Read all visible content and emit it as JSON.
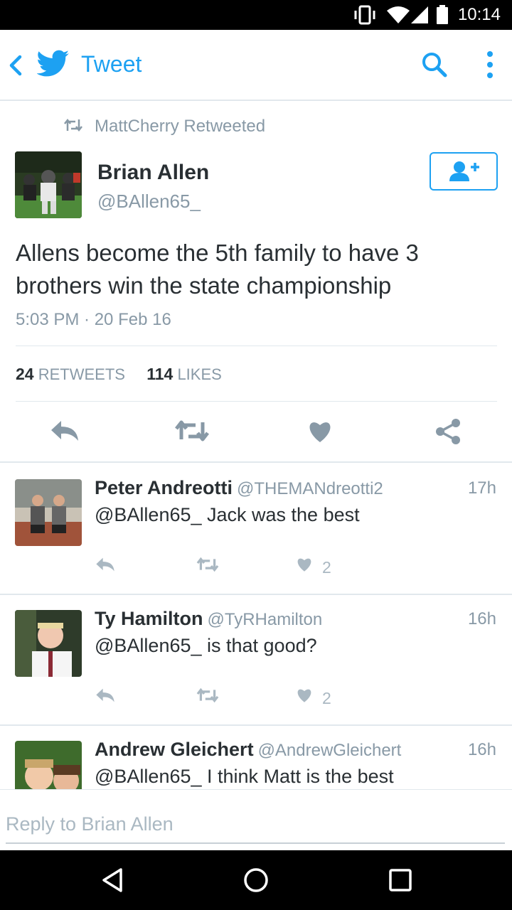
{
  "status_bar": {
    "time": "10:14"
  },
  "app_bar": {
    "back_icon": "chevron-left-icon",
    "logo_icon": "twitter-bird-icon",
    "title": "Tweet",
    "search_icon": "search-icon",
    "menu_icon": "more-vert-icon"
  },
  "tweet": {
    "retweeted_by": "MattCherry Retweeted",
    "author_name": "Brian Allen",
    "author_handle": "@BAllen65_",
    "text": "Allens become the 5th family to have 3 brothers win the state championship",
    "timestamp": "5:03 PM · 20 Feb 16",
    "retweets_count": "24",
    "retweets_label": "RETWEETS",
    "likes_count": "114",
    "likes_label": "LIKES"
  },
  "replies": [
    {
      "name": "Peter Andreotti",
      "handle": "@THEMANdreotti2",
      "ago": "17h",
      "text": "@BAllen65_ Jack was the best",
      "likes": "2"
    },
    {
      "name": "Ty Hamilton",
      "handle": "@TyRHamilton",
      "ago": "16h",
      "text": "@BAllen65_ is that good?",
      "likes": "2"
    },
    {
      "name": "Andrew Gleichert",
      "handle": "@AndrewGleichert",
      "ago": "16h",
      "text": "@BAllen65_ I think Matt is the best",
      "likes": ""
    }
  ],
  "reply_bar": {
    "placeholder": "Reply to Brian Allen"
  },
  "colors": {
    "accent": "#1da1f2",
    "muted": "#8899a6",
    "text": "#292f33",
    "icon_gray": "#657786"
  }
}
